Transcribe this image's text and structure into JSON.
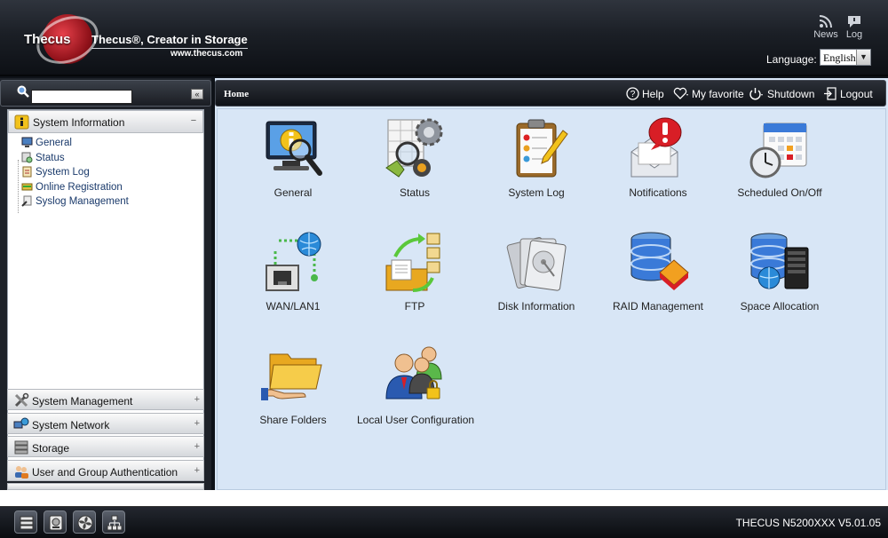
{
  "header": {
    "brand": "Thecus",
    "tagline": "Thecus®, Creator in Storage",
    "site_url": "www.thecus.com",
    "news_label": "News",
    "log_label": "Log",
    "language_label": "Language:",
    "language_value": "English"
  },
  "sidebar": {
    "search_placeholder": "",
    "section_title": "System Information",
    "items": [
      {
        "label": "General",
        "icon": "monitor-icon"
      },
      {
        "label": "Status",
        "icon": "status-icon"
      },
      {
        "label": "System Log",
        "icon": "log-icon"
      },
      {
        "label": "Online Registration",
        "icon": "registration-icon"
      },
      {
        "label": "Syslog Management",
        "icon": "syslog-icon"
      }
    ],
    "accordion": [
      {
        "label": "System Management",
        "icon": "tools-icon"
      },
      {
        "label": "System Network",
        "icon": "network-icon"
      },
      {
        "label": "Storage",
        "icon": "storage-icon"
      },
      {
        "label": "User and Group Authentication",
        "icon": "users-icon"
      }
    ]
  },
  "toolbar": {
    "breadcrumb": "Home",
    "help": "Help",
    "favorite": "My favorite",
    "shutdown": "Shutdown",
    "logout": "Logout"
  },
  "apps": [
    {
      "label": "General",
      "icon": "info-monitor-icon"
    },
    {
      "label": "Status",
      "icon": "status-gear-icon"
    },
    {
      "label": "System Log",
      "icon": "clipboard-log-icon"
    },
    {
      "label": "Notifications",
      "icon": "alert-mail-icon"
    },
    {
      "label": "Scheduled On/Off",
      "icon": "calendar-clock-icon"
    },
    {
      "label": "WAN/LAN1",
      "icon": "network-port-icon"
    },
    {
      "label": "FTP",
      "icon": "ftp-folder-icon"
    },
    {
      "label": "Disk Information",
      "icon": "disk-icon"
    },
    {
      "label": "RAID Management",
      "icon": "raid-icon"
    },
    {
      "label": "Space Allocation",
      "icon": "space-allocation-icon"
    },
    {
      "label": "Share Folders",
      "icon": "share-folder-icon"
    },
    {
      "label": "Local User Configuration",
      "icon": "local-user-icon"
    }
  ],
  "footer": {
    "version": "THECUS N5200XXX V5.01.05"
  },
  "colors": {
    "accent_red": "#c0161e",
    "content_bg": "#d8e6f6",
    "link_blue": "#1a3a6b"
  }
}
